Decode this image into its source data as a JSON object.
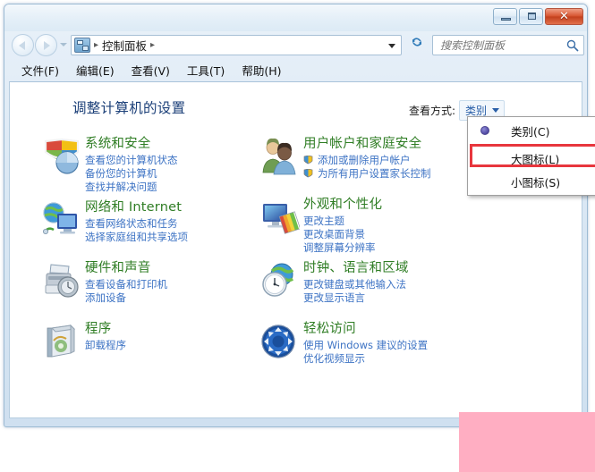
{
  "window": {
    "buttons": {
      "minimize": "minimize",
      "maximize": "maximize",
      "close": "✕"
    }
  },
  "navbar": {
    "back": "back-arrow",
    "forward": "forward-arrow",
    "history_caret": "chevron-down",
    "breadcrumb": {
      "icon": "control-panel-icon",
      "sep1": "▸",
      "root": "控制面板",
      "sep2": "▸"
    },
    "refresh": "↻",
    "search": {
      "placeholder": "搜索控制面板",
      "value": "",
      "icon": "search-icon"
    }
  },
  "menubar": {
    "items": [
      {
        "label": "文件(F)"
      },
      {
        "label": "编辑(E)"
      },
      {
        "label": "查看(V)"
      },
      {
        "label": "工具(T)"
      },
      {
        "label": "帮助(H)"
      }
    ]
  },
  "content": {
    "page_title": "调整计算机的设置",
    "view_by": {
      "label": "查看方式:",
      "value": "类别"
    },
    "categories_left": [
      {
        "icon": "security-shield-icon",
        "title": "系统和安全",
        "links": [
          {
            "text": "查看您的计算机状态",
            "shield": false
          },
          {
            "text": "备份您的计算机",
            "shield": false
          },
          {
            "text": "查找并解决问题",
            "shield": false
          }
        ]
      },
      {
        "icon": "network-globe-icon",
        "title": "网络和 Internet",
        "links": [
          {
            "text": "查看网络状态和任务",
            "shield": false
          },
          {
            "text": "选择家庭组和共享选项",
            "shield": false
          }
        ]
      },
      {
        "icon": "printer-icon",
        "title": "硬件和声音",
        "links": [
          {
            "text": "查看设备和打印机",
            "shield": false
          },
          {
            "text": "添加设备",
            "shield": false
          }
        ]
      },
      {
        "icon": "programs-box-icon",
        "title": "程序",
        "links": [
          {
            "text": "卸载程序",
            "shield": false
          }
        ]
      }
    ],
    "categories_right": [
      {
        "icon": "users-icon",
        "title": "用户帐户和家庭安全",
        "links": [
          {
            "text": "添加或删除用户帐户",
            "shield": true
          },
          {
            "text": "为所有用户设置家长控制",
            "shield": true
          }
        ]
      },
      {
        "icon": "appearance-monitor-icon",
        "title": "外观和个性化",
        "links": [
          {
            "text": "更改主题",
            "shield": false
          },
          {
            "text": "更改桌面背景",
            "shield": false
          },
          {
            "text": "调整屏幕分辨率",
            "shield": false
          }
        ]
      },
      {
        "icon": "clock-globe-icon",
        "title": "时钟、语言和区域",
        "links": [
          {
            "text": "更改键盘或其他输入法",
            "shield": false
          },
          {
            "text": "更改显示语言",
            "shield": false
          }
        ]
      },
      {
        "icon": "ease-of-access-icon",
        "title": "轻松访问",
        "links": [
          {
            "text": "使用 Windows 建议的设置",
            "shield": false
          },
          {
            "text": "优化视频显示",
            "shield": false
          }
        ]
      }
    ]
  },
  "view_menu": {
    "items": [
      {
        "label": "类别(C)",
        "selected": true
      },
      {
        "label": "大图标(L)",
        "selected": false
      },
      {
        "label": "小图标(S)",
        "selected": false
      }
    ],
    "highlight_index": 1,
    "highlight_color": "#e8363d"
  },
  "overlay": {
    "pink_color": "#ffaec2"
  }
}
